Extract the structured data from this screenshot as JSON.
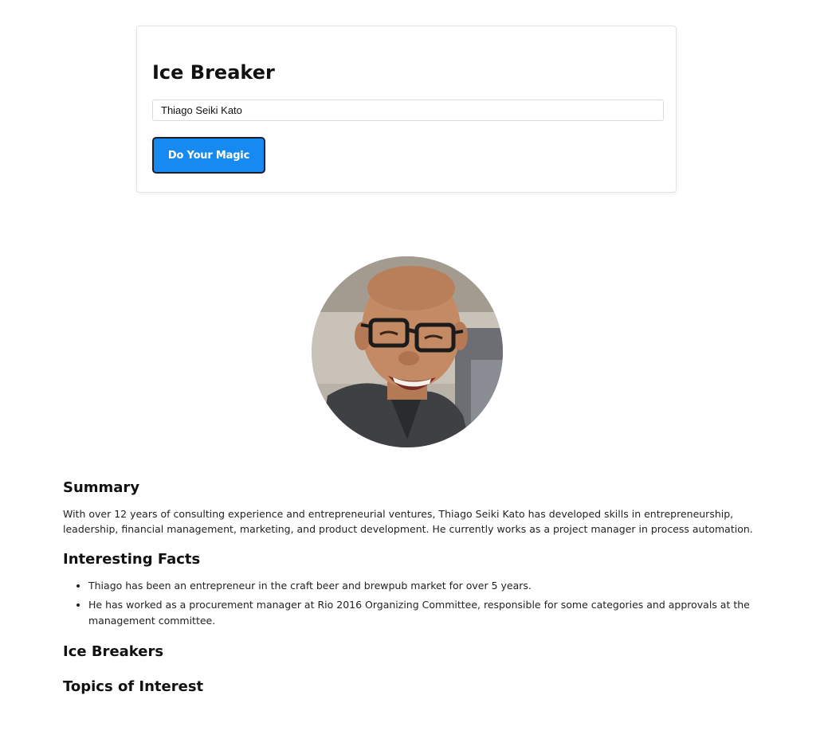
{
  "form": {
    "title": "Ice Breaker",
    "name_value": "Thiago Seiki Kato",
    "submit_label": "Do Your Magic",
    "button_color": "#168af0"
  },
  "profile": {
    "avatar_icon": "profile-photo"
  },
  "sections": {
    "summary_heading": "Summary",
    "summary_text": "With over 12 years of consulting experience and entrepreneurial ventures, Thiago Seiki Kato has developed skills in entrepreneurship, leadership, financial management, marketing, and product development. He currently works as a project manager in process automation.",
    "facts_heading": "Interesting Facts",
    "facts": [
      "Thiago has been an entrepreneur in the craft beer and brewpub market for over 5 years.",
      "He has worked as a procurement manager at Rio 2016 Organizing Committee, responsible for some categories and approvals at the management committee."
    ],
    "icebreakers_heading": "Ice Breakers",
    "topics_heading": "Topics of Interest"
  }
}
